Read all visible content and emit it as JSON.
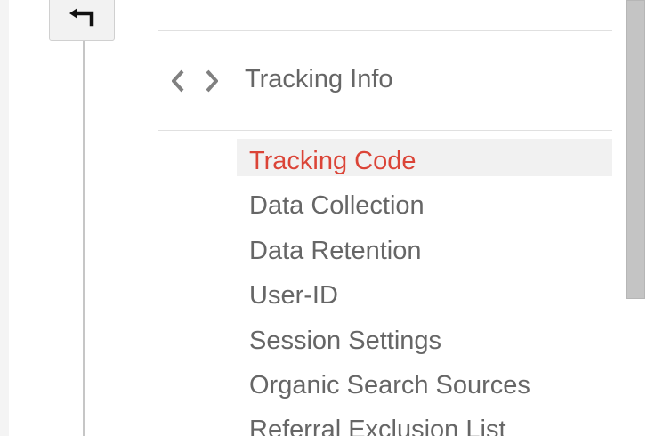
{
  "back_button": {
    "icon": "back-arrow-icon"
  },
  "section": {
    "icon": "code-brackets-icon",
    "title": "Tracking Info"
  },
  "menu": {
    "items": [
      {
        "label": "Tracking Code",
        "active": true
      },
      {
        "label": "Data Collection",
        "active": false
      },
      {
        "label": "Data Retention",
        "active": false
      },
      {
        "label": "User-ID",
        "active": false
      },
      {
        "label": "Session Settings",
        "active": false
      },
      {
        "label": "Organic Search Sources",
        "active": false
      },
      {
        "label": "Referral Exclusion List",
        "active": false
      }
    ]
  },
  "colors": {
    "active_text": "#db4437",
    "text": "#666666",
    "active_background": "#f1f1f1",
    "scrollbar": "#c4c4c4"
  }
}
